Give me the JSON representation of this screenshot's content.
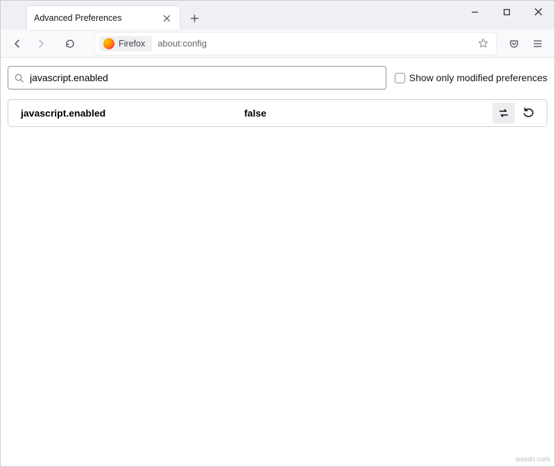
{
  "tab": {
    "title": "Advanced Preferences"
  },
  "urlbar": {
    "identity_label": "Firefox",
    "url": "about:config"
  },
  "search": {
    "value": "javascript.enabled",
    "show_modified_label": "Show only modified preferences"
  },
  "pref": {
    "name": "javascript.enabled",
    "value": "false"
  },
  "watermark": "wsxdn.com"
}
